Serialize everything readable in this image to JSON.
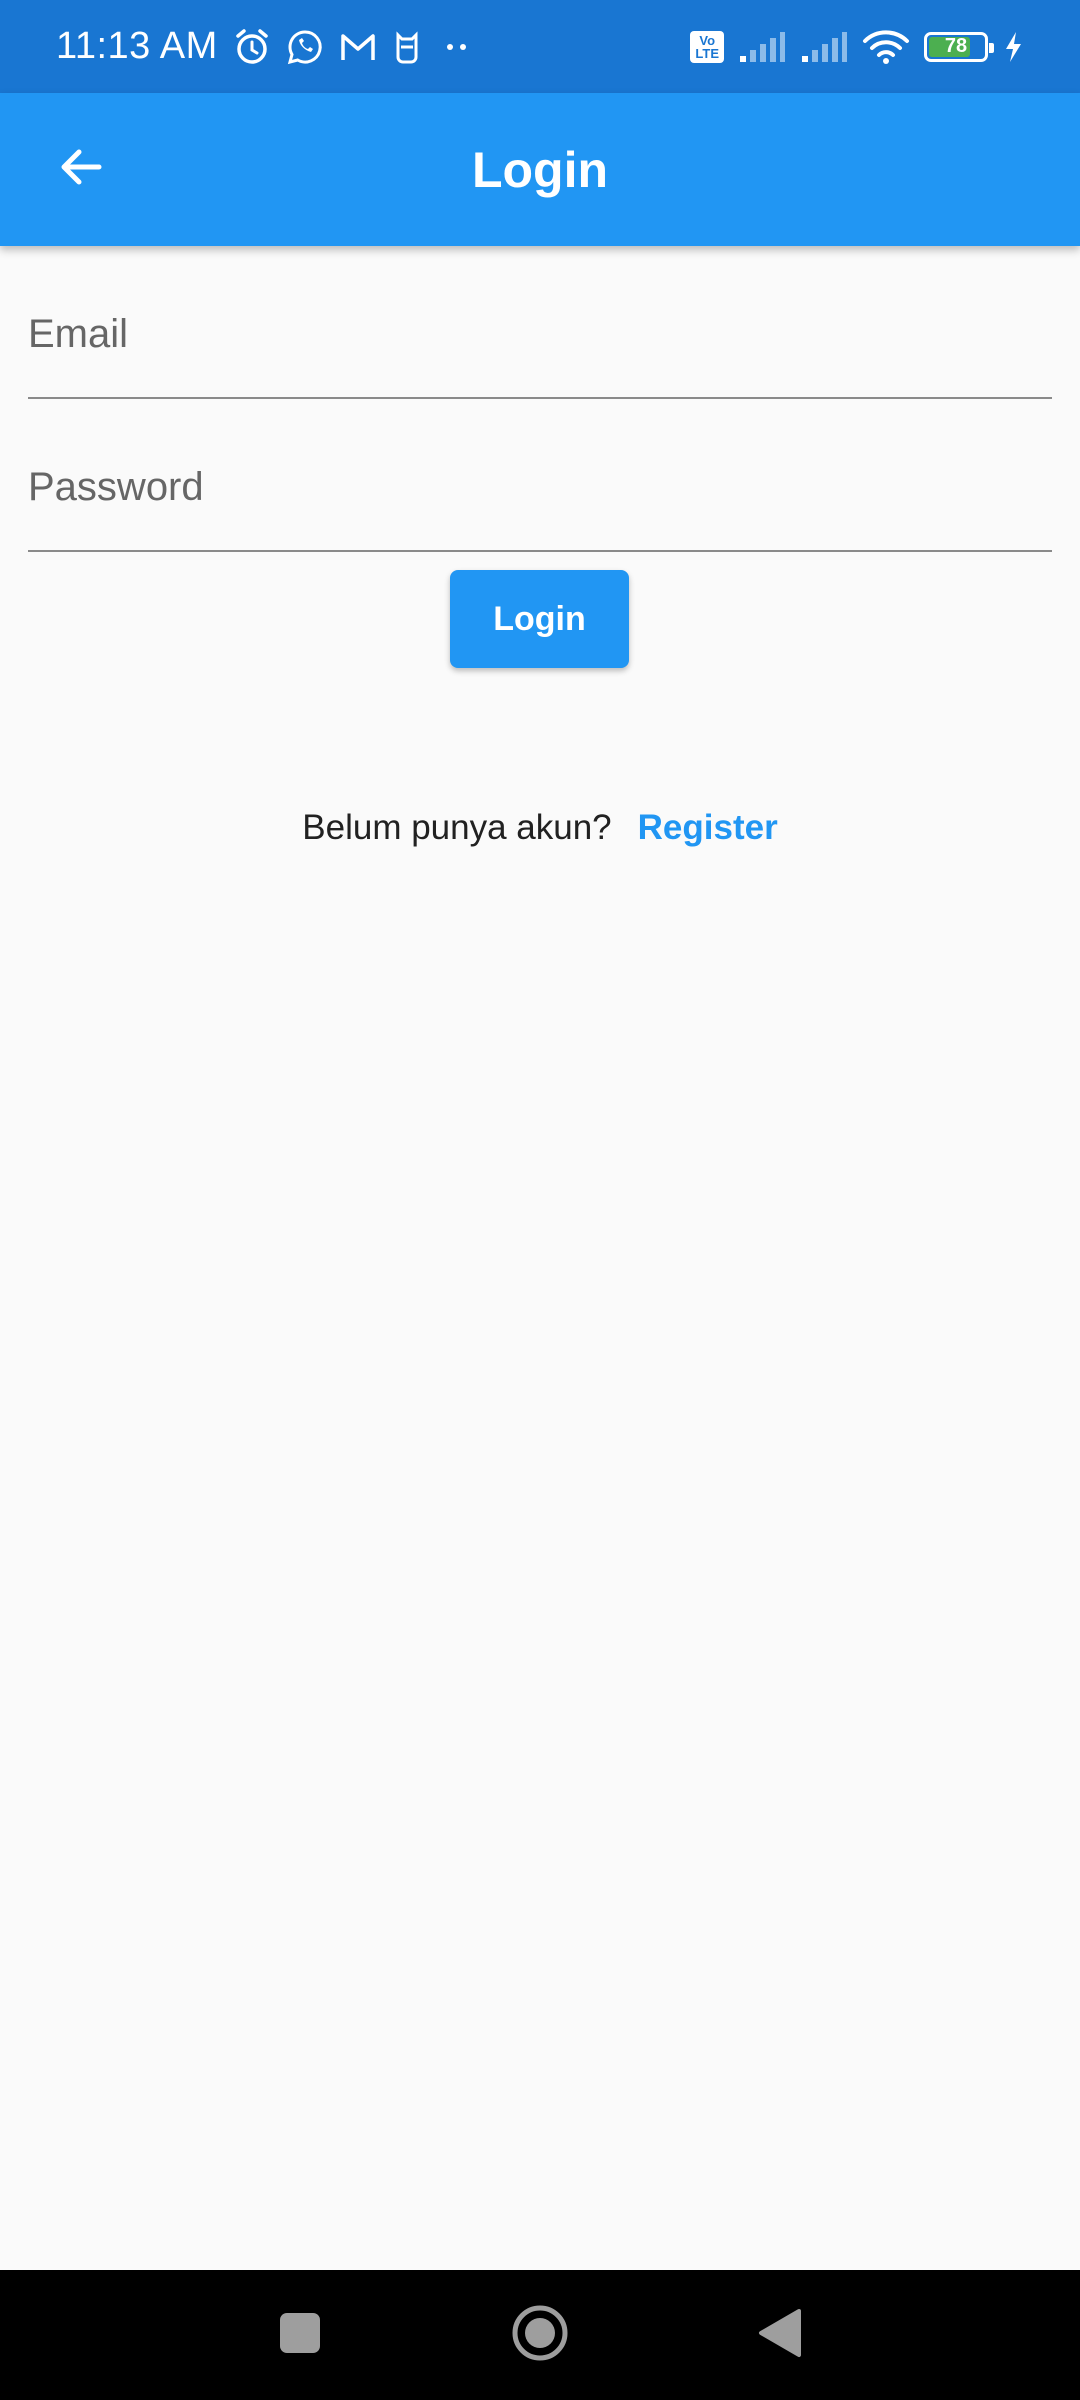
{
  "status_bar": {
    "time": "11:13 AM",
    "battery_level": 78,
    "battery_label": "78",
    "volte_label": "Vo\nLTE",
    "notification_icons": [
      "alarm-icon",
      "whatsapp-icon",
      "gmail-icon",
      "cat-app-icon",
      "more-dots-icon"
    ],
    "system_icons": [
      "volte-icon",
      "signal-sim1-icon",
      "signal-sim2-icon",
      "wifi-icon",
      "battery-icon",
      "charging-icon"
    ]
  },
  "app_bar": {
    "title": "Login",
    "back_icon": "arrow-back-icon",
    "color": "#2196f3"
  },
  "form": {
    "email": {
      "placeholder": "Email",
      "value": ""
    },
    "password": {
      "placeholder": "Password",
      "value": ""
    },
    "login_label": "Login"
  },
  "register": {
    "prompt": "Belum punya akun?",
    "link": "Register",
    "link_color": "#2196f3"
  },
  "nav_bar": {
    "buttons": [
      "recents-icon",
      "home-icon",
      "back-icon"
    ]
  }
}
